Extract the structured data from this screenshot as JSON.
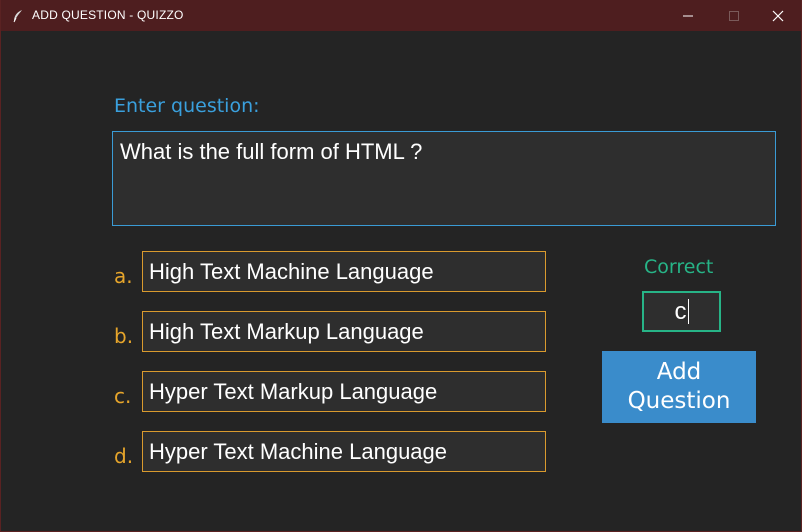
{
  "window": {
    "title": "ADD QUESTION - QUIZZO"
  },
  "form": {
    "question_label": "Enter question:",
    "question_value": "What is the full form of HTML ?",
    "options": [
      {
        "letter": "a.",
        "value": "High Text Machine Language"
      },
      {
        "letter": "b.",
        "value": "High Text Markup Language"
      },
      {
        "letter": "c.",
        "value": "Hyper Text Markup Language"
      },
      {
        "letter": "d.",
        "value": "Hyper Text Machine Language"
      }
    ],
    "correct_label": "Correct",
    "correct_value": "c",
    "add_button_label": "Add Question"
  },
  "colors": {
    "titlebar": "#4e1e1f",
    "background": "#242424",
    "question_accent": "#3a9bd5",
    "option_accent": "#d99a2e",
    "correct_accent": "#27b487",
    "button": "#3a8ccb"
  },
  "icons": {
    "app": "feather-icon",
    "minimize": "minimize-icon",
    "maximize": "maximize-icon",
    "close": "close-icon"
  }
}
